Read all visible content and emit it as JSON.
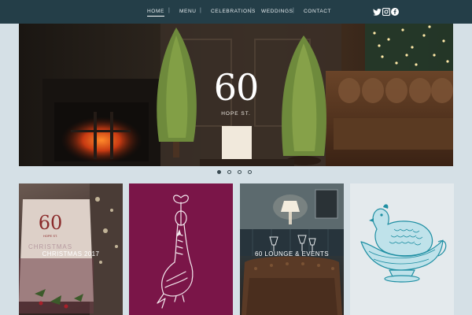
{
  "nav": {
    "items": [
      {
        "label": "HOME",
        "active": true
      },
      {
        "label": "MENU"
      },
      {
        "label": "CELEBRATIONS"
      },
      {
        "label": "WEDDINGS"
      },
      {
        "label": "CONTACT"
      }
    ],
    "separator": "|",
    "social": [
      "twitter-icon",
      "instagram-icon",
      "facebook-icon"
    ],
    "colors": {
      "bar": "#243e48",
      "text": "#e8eef1"
    }
  },
  "hero": {
    "logo": "60",
    "subtitle": "HOPE ST.",
    "slides": 4,
    "active_slide": 1
  },
  "tiles": [
    {
      "label": "CHRISTMAS 2017",
      "card_logo": "60",
      "card_sub": "HOPE ST.",
      "card_word": "CHRISTMAS"
    },
    {
      "label": ""
    },
    {
      "label": "60 LOUNGE & EVENTS"
    },
    {
      "label": ""
    }
  ],
  "colors": {
    "background": "#d5e0e6",
    "tile_magenta": "#7a1548",
    "illustration_teal": "#1f8fa3"
  }
}
